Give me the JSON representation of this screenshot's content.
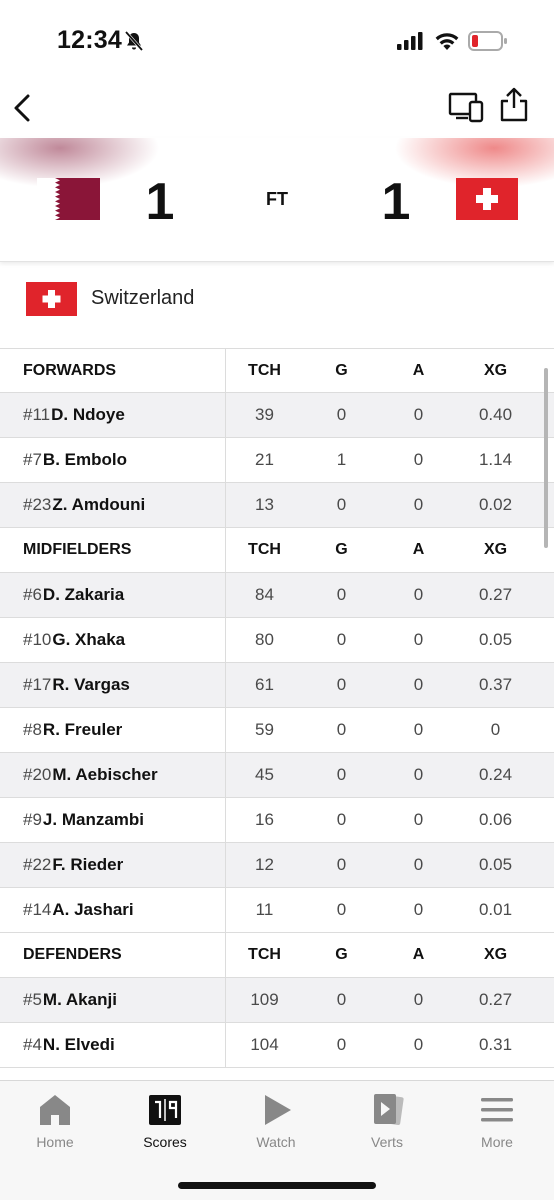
{
  "status_bar": {
    "time": "12:34"
  },
  "match": {
    "home_score": "1",
    "away_score": "1",
    "status": "FT"
  },
  "team": {
    "name": "Switzerland"
  },
  "table": {
    "sections": [
      {
        "title": "FORWARDS",
        "columns": [
          "TCH",
          "G",
          "A",
          "XG"
        ],
        "players": [
          {
            "number": "#11",
            "name": "D. Ndoye",
            "tch": "39",
            "g": "0",
            "a": "0",
            "xg": "0.40"
          },
          {
            "number": "#7",
            "name": "B. Embolo",
            "tch": "21",
            "g": "1",
            "a": "0",
            "xg": "1.14"
          },
          {
            "number": "#23",
            "name": "Z. Amdouni",
            "tch": "13",
            "g": "0",
            "a": "0",
            "xg": "0.02"
          }
        ]
      },
      {
        "title": "MIDFIELDERS",
        "columns": [
          "TCH",
          "G",
          "A",
          "XG"
        ],
        "players": [
          {
            "number": "#6",
            "name": "D. Zakaria",
            "tch": "84",
            "g": "0",
            "a": "0",
            "xg": "0.27"
          },
          {
            "number": "#10",
            "name": "G. Xhaka",
            "tch": "80",
            "g": "0",
            "a": "0",
            "xg": "0.05"
          },
          {
            "number": "#17",
            "name": "R. Vargas",
            "tch": "61",
            "g": "0",
            "a": "0",
            "xg": "0.37"
          },
          {
            "number": "#8",
            "name": "R. Freuler",
            "tch": "59",
            "g": "0",
            "a": "0",
            "xg": "0"
          },
          {
            "number": "#20",
            "name": "M. Aebischer",
            "tch": "45",
            "g": "0",
            "a": "0",
            "xg": "0.24"
          },
          {
            "number": "#9",
            "name": "J. Manzambi",
            "tch": "16",
            "g": "0",
            "a": "0",
            "xg": "0.06"
          },
          {
            "number": "#22",
            "name": "F. Rieder",
            "tch": "12",
            "g": "0",
            "a": "0",
            "xg": "0.05"
          },
          {
            "number": "#14",
            "name": "A. Jashari",
            "tch": "11",
            "g": "0",
            "a": "0",
            "xg": "0.01"
          }
        ]
      },
      {
        "title": "DEFENDERS",
        "columns": [
          "TCH",
          "G",
          "A",
          "XG"
        ],
        "players": [
          {
            "number": "#5",
            "name": "M. Akanji",
            "tch": "109",
            "g": "0",
            "a": "0",
            "xg": "0.27"
          },
          {
            "number": "#4",
            "name": "N. Elvedi",
            "tch": "104",
            "g": "0",
            "a": "0",
            "xg": "0.31"
          }
        ]
      }
    ]
  },
  "tab_bar": {
    "tabs": [
      {
        "label": "Home",
        "icon": "home-icon",
        "active": false
      },
      {
        "label": "Scores",
        "icon": "scoreboard-icon",
        "active": true
      },
      {
        "label": "Watch",
        "icon": "play-icon",
        "active": false
      },
      {
        "label": "Verts",
        "icon": "verts-icon",
        "active": false
      },
      {
        "label": "More",
        "icon": "menu-icon",
        "active": false
      }
    ]
  },
  "colors": {
    "qatar_maroon": "#8A1538",
    "swiss_red": "#E0242B",
    "row_shade": "#f1f1f3",
    "tab_inactive": "#888888"
  }
}
